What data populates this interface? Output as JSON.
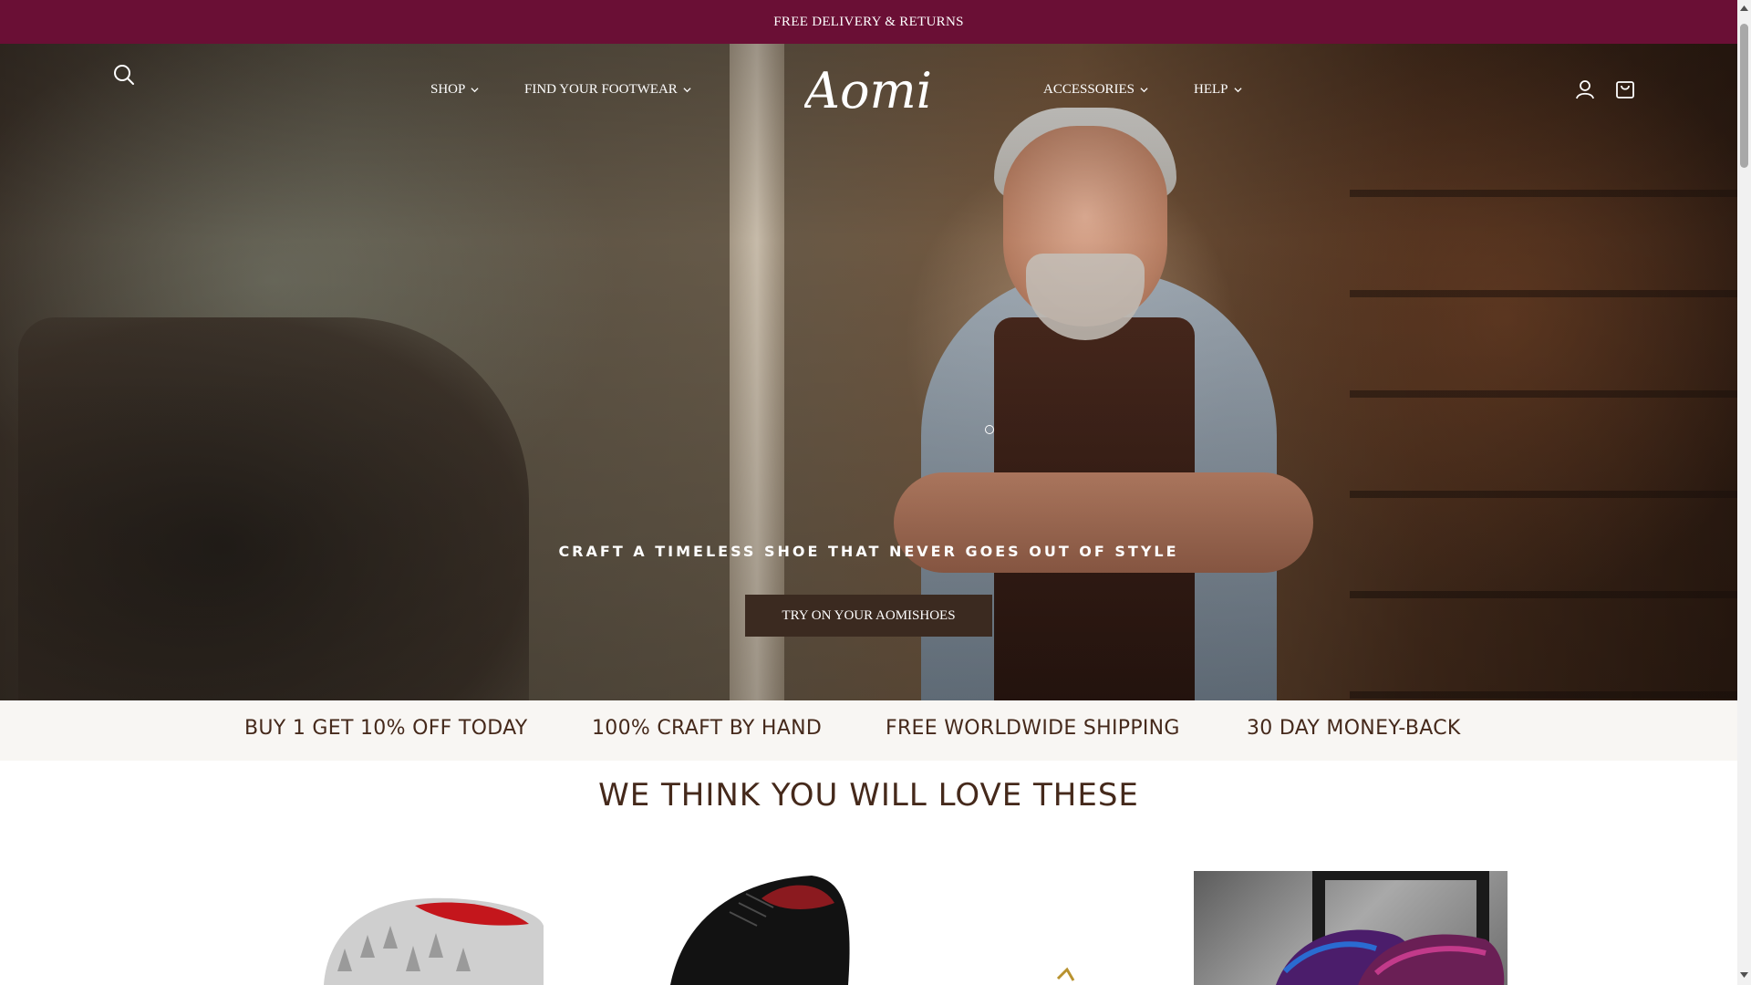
{
  "announcement": {
    "text": "FREE DELIVERY & RETURNS"
  },
  "header": {
    "nav_left": [
      {
        "label": "SHOP"
      },
      {
        "label": "FIND YOUR FOOTWEAR"
      }
    ],
    "logo_text": "Aomi",
    "nav_right": [
      {
        "label": "ACCESSORIES"
      },
      {
        "label": "HELP"
      }
    ],
    "icons": [
      "search-icon",
      "account-icon",
      "cart-icon"
    ]
  },
  "hero": {
    "headline": "CRAFT A TIMELESS SHOE THAT NEVER GOES OUT OF STYLE",
    "cta_label": "TRY ON YOUR AOMISHOES"
  },
  "usp": [
    {
      "text": "BUY 1 GET 10% OFF TODAY"
    },
    {
      "text": "100% CRAFT BY HAND"
    },
    {
      "text": "FREE WORLDWIDE SHIPPING"
    },
    {
      "text": "30 DAY MONEY-BACK"
    }
  ],
  "products_section": {
    "title": "WE THINK YOU WILL LOVE THESE"
  },
  "colors": {
    "announcement_bg": "#6a0f35",
    "cta_bg": "#3b2a20",
    "heading_text": "#45291b",
    "usp_bg": "#f8f6f3"
  }
}
